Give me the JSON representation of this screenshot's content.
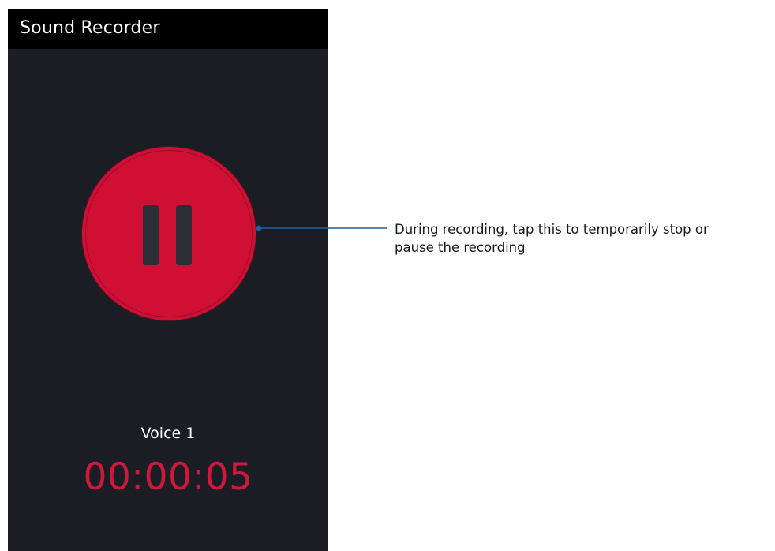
{
  "app": {
    "title": "Sound Recorder"
  },
  "recorder": {
    "state": "recording",
    "control_icon": "pause-icon",
    "recording_name": "Voice 1",
    "elapsed_time": "00:00:05"
  },
  "annotation": {
    "text_line1": "During recording, tap this to temporarily stop or",
    "text_line2": "pause the recording"
  },
  "colors": {
    "accent": "#cf1034",
    "timer": "#d0183d",
    "background": "#1b1d24",
    "app_bar": "#000000",
    "callout_line": "#1f5fa0"
  }
}
